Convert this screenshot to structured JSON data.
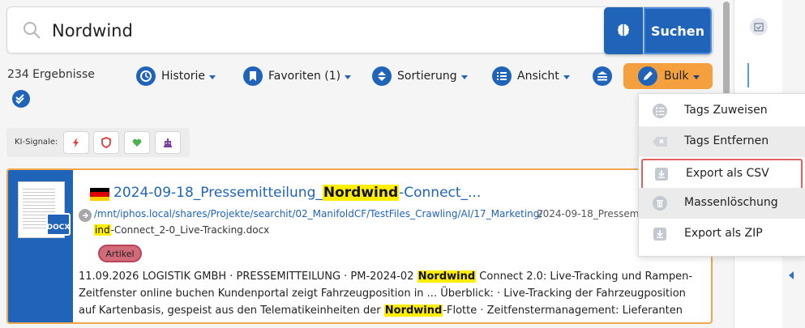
{
  "search": {
    "value": "Nordwind",
    "submit_label": "Suchen"
  },
  "results": {
    "count_text": "234 Ergebnisse"
  },
  "toolbar": {
    "history_label": "Historie",
    "favorites_label": "Favoriten (1)",
    "sort_label": "Sortierung",
    "view_label": "Ansicht",
    "bulk_label": "Bulk"
  },
  "ki_signals": {
    "label": "KI-Signale:",
    "chips": [
      "lightning-icon",
      "shield-icon",
      "heart-icon",
      "robot-icon"
    ]
  },
  "bulk_menu": {
    "items": [
      {
        "label": "Tags Zuweisen",
        "icon": "checklist-icon"
      },
      {
        "label": "Tags Entfernen",
        "icon": "tag-remove-icon"
      },
      {
        "label": "Export als CSV",
        "icon": "download-icon"
      },
      {
        "label": "Massenlöschung",
        "icon": "trash-icon"
      },
      {
        "label": "Export als ZIP",
        "icon": "download-icon"
      }
    ]
  },
  "result_card": {
    "title_pre": "2024-09-18_Pressemitteilung_",
    "title_mark": "Nordwind",
    "title_post": "-Connect_...",
    "path_line1": "/mnt/iphos.local/shares/Projekte/searchit/02_ManifoldCF/TestFiles_Crawling/AI/17_Marketing/",
    "path_line2_mark": "ind",
    "path_line2_rest": "-Connect_2-0_Live-Tracking.docx",
    "path_right": "2024-09-18_Pressemitte",
    "tag": "Artikel",
    "file_badge": "DOCX",
    "snippet_1": "11.09.2026   LOGISTIK GMBH · PRESSEMITTEILUNG · PM-2024-02 ",
    "snippet_mark1": "Nordwind",
    "snippet_2": " Connect 2.0: Live-Tracking und Rampen-Zeitfenster online buchen Kundenportal zeigt Fahrzeugposition in ... Überblick: · Live-Tracking der Fahrzeugposition auf Kartenbasis, gespeist aus den Telematikeinheiten der ",
    "snippet_mark2": "Nordwind",
    "snippet_3": "-Flotte · Zeitfenstermanagement: Lieferanten ..."
  },
  "colors": {
    "primary": "#1f64b8",
    "accent": "#f4a03e",
    "highlight": "#ffee00",
    "tag": "#d36a7a"
  }
}
